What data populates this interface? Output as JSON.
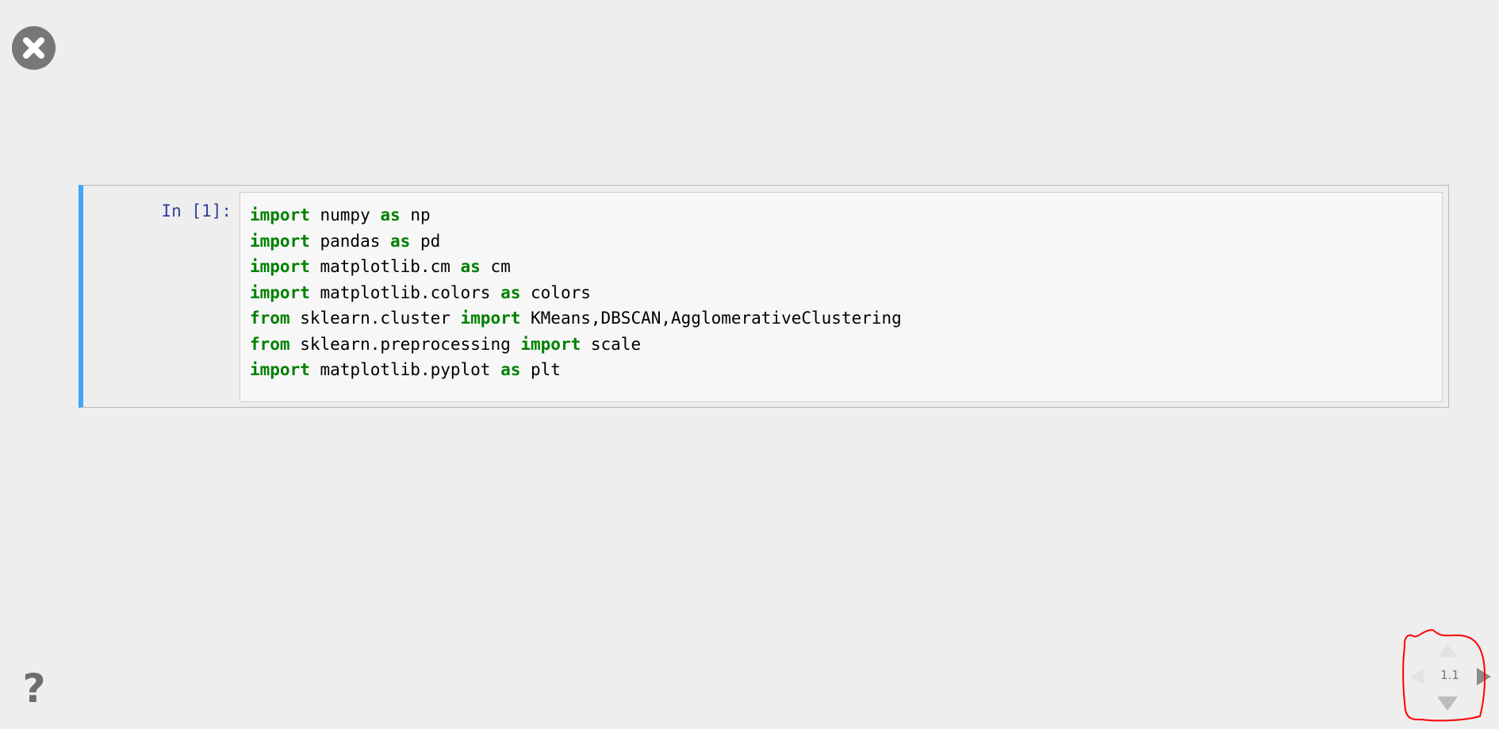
{
  "controls": {
    "close_icon": "close-icon",
    "help_label": "?",
    "help_icon": "question-icon"
  },
  "cell": {
    "prompt": "In [1]:",
    "accent_color": "#42a5f5",
    "keyword_color": "#008000",
    "prompt_color": "#303f9f",
    "code_lines": [
      [
        {
          "t": "import",
          "kw": true
        },
        {
          "t": " numpy "
        },
        {
          "t": "as",
          "kw": true
        },
        {
          "t": " np"
        }
      ],
      [
        {
          "t": "import",
          "kw": true
        },
        {
          "t": " pandas "
        },
        {
          "t": "as",
          "kw": true
        },
        {
          "t": " pd"
        }
      ],
      [
        {
          "t": "import",
          "kw": true
        },
        {
          "t": " matplotlib.cm "
        },
        {
          "t": "as",
          "kw": true
        },
        {
          "t": " cm"
        }
      ],
      [
        {
          "t": "import",
          "kw": true
        },
        {
          "t": " matplotlib.colors "
        },
        {
          "t": "as",
          "kw": true
        },
        {
          "t": " colors"
        }
      ],
      [
        {
          "t": "from",
          "kw": true
        },
        {
          "t": " sklearn.cluster "
        },
        {
          "t": "import",
          "kw": true
        },
        {
          "t": " KMeans,DBSCAN,AgglomerativeClustering"
        }
      ],
      [
        {
          "t": "from",
          "kw": true
        },
        {
          "t": " sklearn.preprocessing "
        },
        {
          "t": "import",
          "kw": true
        },
        {
          "t": " scale"
        }
      ],
      [
        {
          "t": "import",
          "kw": true
        },
        {
          "t": " matplotlib.pyplot "
        },
        {
          "t": "as",
          "kw": true
        },
        {
          "t": " plt"
        }
      ]
    ]
  },
  "navigation": {
    "slide_number": "1.1",
    "arrows": [
      "up-arrow-icon",
      "left-arrow-icon",
      "right-arrow-icon",
      "down-arrow-icon"
    ],
    "annotation_color": "#ff0000"
  }
}
